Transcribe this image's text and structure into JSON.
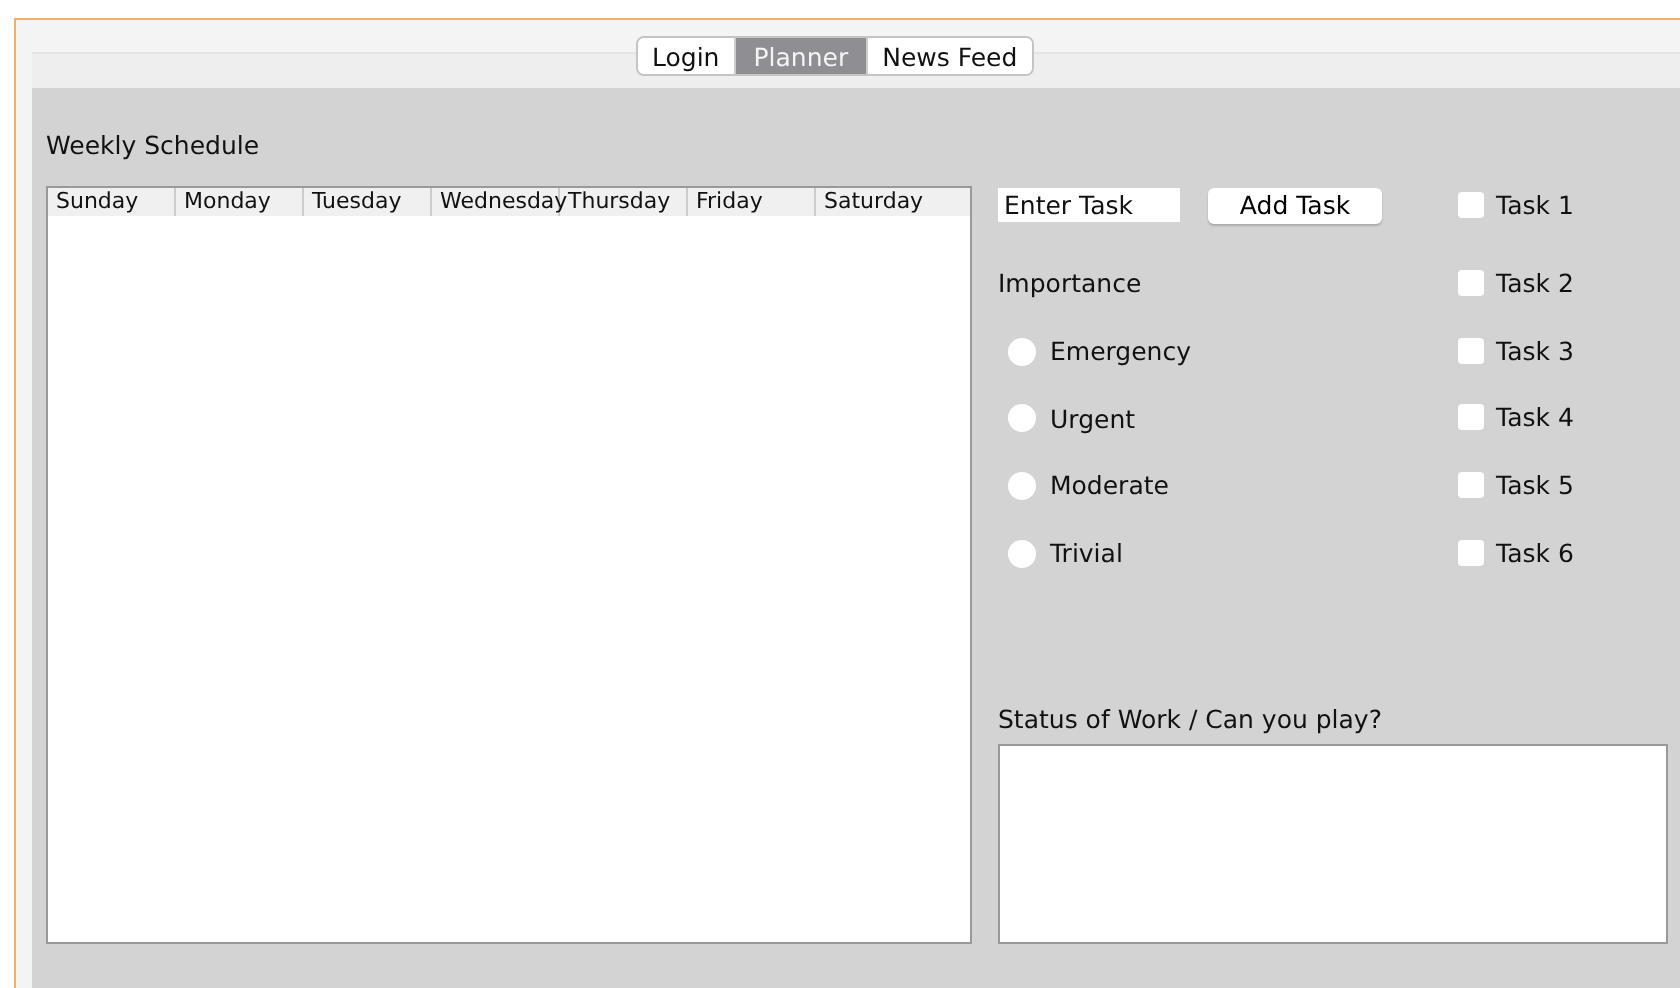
{
  "tabs": [
    {
      "label": "Login",
      "selected": false
    },
    {
      "label": "Planner",
      "selected": true
    },
    {
      "label": "News Feed",
      "selected": false
    }
  ],
  "schedule": {
    "title": "Weekly Schedule",
    "columns": [
      "Sunday",
      "Monday",
      "Tuesday",
      "Wednesday",
      "Thursday",
      "Friday",
      "Saturday"
    ]
  },
  "task_entry": {
    "placeholder": "Enter Task",
    "button": "Add Task"
  },
  "importance": {
    "label": "Importance",
    "options": [
      {
        "label": "Emergency",
        "selected": false
      },
      {
        "label": "Urgent",
        "selected": false
      },
      {
        "label": "Moderate",
        "selected": false
      },
      {
        "label": "Trivial",
        "selected": false
      }
    ]
  },
  "tasks": [
    {
      "label": "Task 1",
      "checked": false
    },
    {
      "label": "Task 2",
      "checked": false
    },
    {
      "label": "Task 3",
      "checked": false
    },
    {
      "label": "Task 4",
      "checked": false
    },
    {
      "label": "Task 5",
      "checked": false
    },
    {
      "label": "Task 6",
      "checked": false
    }
  ],
  "status": {
    "label": "Status of Work / Can you play?"
  }
}
